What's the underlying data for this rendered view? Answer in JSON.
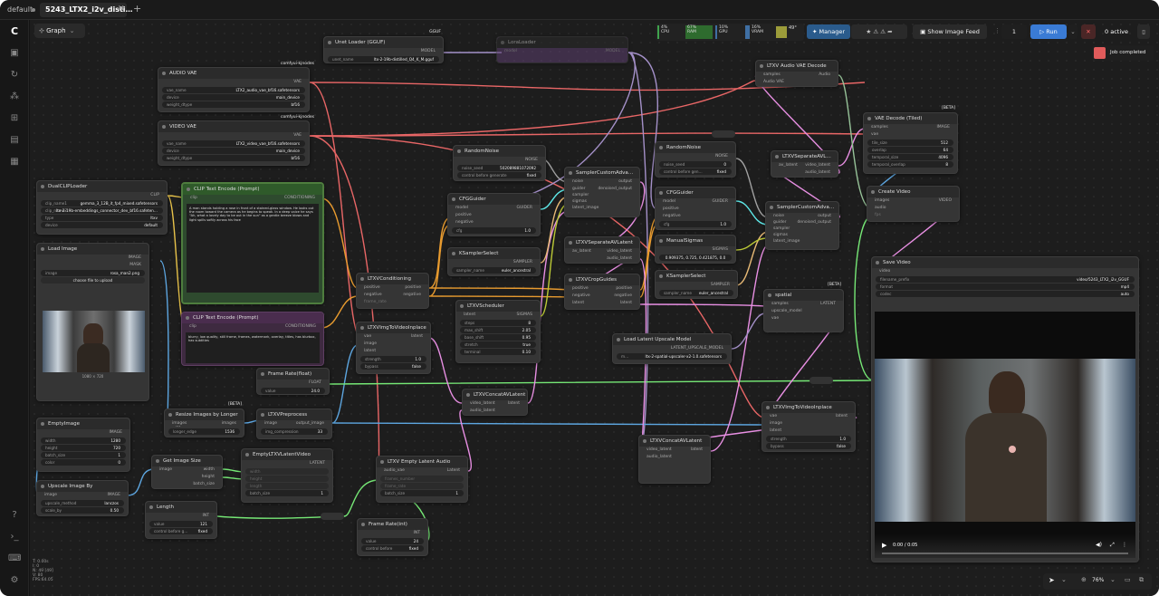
{
  "tabs": {
    "workflow": "default",
    "active": "5243_LTX2_i2v_disti…",
    "add": "+"
  },
  "graph": {
    "label": "Graph"
  },
  "stats": {
    "cpu_pct": "4%",
    "cpu": "CPU",
    "ram_pct": "67%",
    "ram": "RAM",
    "gpu_pct": "10%",
    "gpu": "GPU",
    "vram_pct": "16%",
    "vram": "VRAM",
    "temp": "49°"
  },
  "toolbar": {
    "manager": "Manager",
    "show_image_feed": "Show Image Feed",
    "queue_count": "1",
    "run": "Run",
    "active": "0 active"
  },
  "toast": {
    "text": "Job completed"
  },
  "status": {
    "l1": "T: 0.00s",
    "l2": "I: 0",
    "l3": "N: 49 [49]",
    "l4": "V: 80",
    "l5": "FPS:64.05"
  },
  "zoom": "76%",
  "video": {
    "time": "0:00 / 0:05"
  },
  "groups": {
    "comfy_kjnodes": "comfyui-kjnodes",
    "comfy_kjnodes2": "comfyui-kjnodes",
    "beta": "[BETA]"
  },
  "nodes": {
    "unet": {
      "title": "Unet Loader (GGUF)",
      "out": "MODEL",
      "w_label": "unet_name",
      "w_value": "ltx-2-19b-distilled_Q4_K_M.gguf",
      "tag": "GGUF"
    },
    "lora": {
      "title": "LoraLoader",
      "in": "model",
      "out": "MODEL"
    },
    "audio_vae": {
      "title": "AUDIO VAE",
      "out": "VAE",
      "w1l": "vae_name",
      "w1v": "LTX2_audio_vae_bf16.safetensors",
      "w2l": "device",
      "w2v": "main_device",
      "w3l": "weight_dtype",
      "w3v": "bf16"
    },
    "video_vae": {
      "title": "VIDEO VAE",
      "out": "VAE",
      "w1l": "vae_name",
      "w1v": "LTX2_video_vae_bf16.safetensors",
      "w2l": "device",
      "w2v": "main_device",
      "w3l": "weight_dtype",
      "w3v": "bf16"
    },
    "dualclip": {
      "title": "DualCLIPLoader",
      "out": "CLIP",
      "w1l": "clip_name1",
      "w1v": "gemma_3_12B_it_fp4_mixed.safetensors",
      "w2l": "clip_name2",
      "w2v": "ltx-2-19b-embeddings_connector_dev_bf16.safeten…",
      "w3l": "type",
      "w3v": "ltxv",
      "w4l": "device",
      "w4v": "default"
    },
    "clip_pos": {
      "title": "CLIP Text Encode (Prompt)",
      "in": "clip",
      "out": "CONDITIONING",
      "text": "A man stands holding a rose in front of a stained-glass window. He looks out the room toward the camera as he begins to speak. In a deep voice he says \"Ah, what a lovely day to be out in the sun\" as a gentle breeze blows and light spills softly across his face"
    },
    "clip_neg": {
      "title": "CLIP Text Encode (Prompt)",
      "in": "clip",
      "out": "CONDITIONING",
      "text": "blurry, low quality, still frame, frames, watermark, overlay, titles, has blurbox, has subtitles"
    },
    "load_image": {
      "title": "Load Image",
      "out1": "IMAGE",
      "out2": "MASK",
      "w1l": "image",
      "w1v": "rosa_man2.png",
      "upload": "choose file to upload",
      "caption": "1080 × 720"
    },
    "empty_image": {
      "title": "EmptyImage",
      "out": "IMAGE",
      "w1l": "width",
      "w1v": "1280",
      "w2l": "height",
      "w2v": "720",
      "w3l": "batch_size",
      "w3v": "1",
      "w4l": "color",
      "w4v": "0"
    },
    "upscale_by": {
      "title": "Upscale Image By",
      "in": "image",
      "out": "IMAGE",
      "w1l": "upscale_method",
      "w1v": "lanczos",
      "w2l": "scale_by",
      "w2v": "0.50"
    },
    "resize": {
      "title": "Resize Images by Longer …",
      "in": "images",
      "out": "images",
      "w1l": "longer_edge",
      "w1v": "1536"
    },
    "get_size": {
      "title": "Get Image Size",
      "in": "image",
      "o1": "width",
      "o2": "height",
      "o3": "batch_size"
    },
    "length": {
      "title": "Length",
      "out": "INT",
      "w1l": "value",
      "w1v": "121",
      "w2l": "control before g…",
      "w2v": "fixed"
    },
    "frame_float": {
      "title": "Frame Rate(float)",
      "out": "FLOAT",
      "w1l": "value",
      "w1v": "24.0"
    },
    "preprocess": {
      "title": "LTXVPreprocess",
      "in": "image",
      "out": "output_image",
      "w1l": "img_compression",
      "w1v": "33"
    },
    "empty_latent": {
      "title": "EmptyLTXVLatentVideo",
      "out": "LATENT",
      "i1": "width",
      "i2": "height",
      "i3": "length",
      "w1l": "batch_size",
      "w1v": "1"
    },
    "conditioning": {
      "title": "LTXVConditioning",
      "i1": "positive",
      "i2": "negative",
      "o1": "positive",
      "o2": "negative",
      "w1l": "frame_rate"
    },
    "img2vid": {
      "title": "LTXVImgToVideoInplace",
      "i1": "vae",
      "i2": "image",
      "i3": "latent",
      "out": "latent",
      "w1l": "strength",
      "w1v": "1.0",
      "w2l": "bypass",
      "w2v": "false"
    },
    "empty_audio": {
      "title": "LTXV Empty Latent Audio",
      "in": "audio_vae",
      "out": "Latent",
      "i1": "frames_number",
      "i2": "frame_rate",
      "w1l": "batch_size",
      "w1v": "1"
    },
    "frame_int": {
      "title": "Frame Rate(int)",
      "out": "INT",
      "w1l": "value",
      "w1v": "24",
      "w2l": "control before",
      "w2v": "fixed"
    },
    "noise1": {
      "title": "RandomNoise",
      "out": "NOISE",
      "w1l": "noise_seed",
      "w1v": "502089881072092",
      "w2l": "control before generate",
      "w2v": "fixed"
    },
    "cfg1": {
      "title": "CFGGuider",
      "out": "GUIDER",
      "i1": "model",
      "i2": "positive",
      "i3": "negative",
      "w1l": "cfg",
      "w1v": "1.0"
    },
    "ksel1": {
      "title": "KSamplerSelect",
      "out": "SAMPLER",
      "w1l": "sampler_name",
      "w1v": "euler_ancestral"
    },
    "sched": {
      "title": "LTXVScheduler",
      "in": "latent",
      "out": "SIGMAS",
      "w1l": "steps",
      "w1v": "8",
      "w2l": "max_shift",
      "w2v": "2.05",
      "w3l": "base_shift",
      "w3v": "0.95",
      "w4l": "stretch",
      "w4v": "true",
      "w5l": "terminal",
      "w5v": "0.10"
    },
    "concat1": {
      "title": "LTXVConcatAVLatent",
      "i1": "video_latent",
      "i2": "audio_latent",
      "out": "latent"
    },
    "sampler1": {
      "title": "SamplerCustomAdva…",
      "i1": "noise",
      "i2": "guider",
      "i3": "sampler",
      "i4": "sigmas",
      "i5": "latent_image",
      "o1": "output",
      "o2": "denoised_output"
    },
    "sep1": {
      "title": "LTXVSeparateAVLatent",
      "in": "av_latent",
      "o1": "video_latent",
      "o2": "audio_latent"
    },
    "crop": {
      "title": "LTXVCropGuides",
      "i1": "positive",
      "i2": "negative",
      "i3": "latent",
      "o1": "positive",
      "o2": "negative",
      "o3": "latent"
    },
    "noise2": {
      "title": "RandomNoise",
      "out": "NOISE",
      "w1l": "noise_seed",
      "w1v": "0",
      "w2l": "control before gen…",
      "w2v": "fixed"
    },
    "cfg2": {
      "title": "CFGGuider",
      "out": "GUIDER",
      "i1": "model",
      "i2": "positive",
      "i3": "negative",
      "w1l": "cfg",
      "w1v": "1.0"
    },
    "sigmas": {
      "title": "ManualSigmas",
      "out": "SIGMAS",
      "w1v": "0.909375, 0.725, 0.421875, 0.0"
    },
    "ksel2": {
      "title": "KSamplerSelect",
      "out": "SAMPLER",
      "w1l": "sampler_name",
      "w1v": "euler_ancestral"
    },
    "latent_up": {
      "title": "Load Latent Upscale Model",
      "out": "LATENT_UPSCALE_MODEL",
      "w1l": "m…",
      "w1v": "ltx-2-spatial-upscaler-x2-1.0.safetensors"
    },
    "spatial": {
      "title": "spatial",
      "i1": "samples",
      "i2": "upscale_model",
      "i3": "vae",
      "out": "LATENT"
    },
    "audio_decode": {
      "title": "LTXV Audio VAE Decode",
      "i1": "samples",
      "i2": "Audio VAE",
      "out": "Audio"
    },
    "sep2": {
      "title": "LTXVSeparateAVL…",
      "in": "av_latent",
      "o1": "video_latent",
      "o2": "audio_latent"
    },
    "sampler2": {
      "title": "SamplerCustomAdva…",
      "i1": "noise",
      "i2": "guider",
      "i3": "sampler",
      "i4": "sigmas",
      "i5": "latent_image",
      "o1": "output",
      "o2": "denoised_output"
    },
    "img2vid2": {
      "title": "LTXVImgToVideoInplace",
      "i1": "vae",
      "i2": "image",
      "i3": "latent",
      "out": "latent",
      "w1l": "strength",
      "w1v": "1.0",
      "w2l": "bypass",
      "w2v": "false"
    },
    "concat2": {
      "title": "LTXVConcatAVLatent",
      "i1": "video_latent",
      "i2": "audio_latent",
      "out": "latent"
    },
    "vae_decode": {
      "title": "VAE Decode (Tiled)",
      "i1": "samples",
      "i2": "vae",
      "out": "IMAGE",
      "w1l": "tile_size",
      "w1v": "512",
      "w2l": "overlap",
      "w2v": "64",
      "w3l": "temporal_size",
      "w3v": "4096",
      "w4l": "temporal_overlap",
      "w4v": "8"
    },
    "create_video": {
      "title": "Create Video",
      "i1": "images",
      "i2": "audio",
      "i3": "fps",
      "out": "VIDEO"
    },
    "save_video": {
      "title": "Save Video",
      "in": "video",
      "w1l": "filename_prefix",
      "w1v": "video/5243_LTX2_i2v_GGUF",
      "w2l": "format",
      "w2v": "mp4",
      "w3l": "codec",
      "w3v": "auto"
    }
  },
  "colors": {
    "model": "#b39ddb",
    "clip": "#ffd54f",
    "vae": "#ff6e6e",
    "cond": "#ffa931",
    "latent": "#ff9cf9",
    "image": "#64b5f6",
    "int": "#80ff80",
    "noise": "#b0b0b0",
    "sigmas": "#cddc39",
    "guider": "#66ffff",
    "sampler": "#ffcc80",
    "audio": "#a5d6a7"
  }
}
